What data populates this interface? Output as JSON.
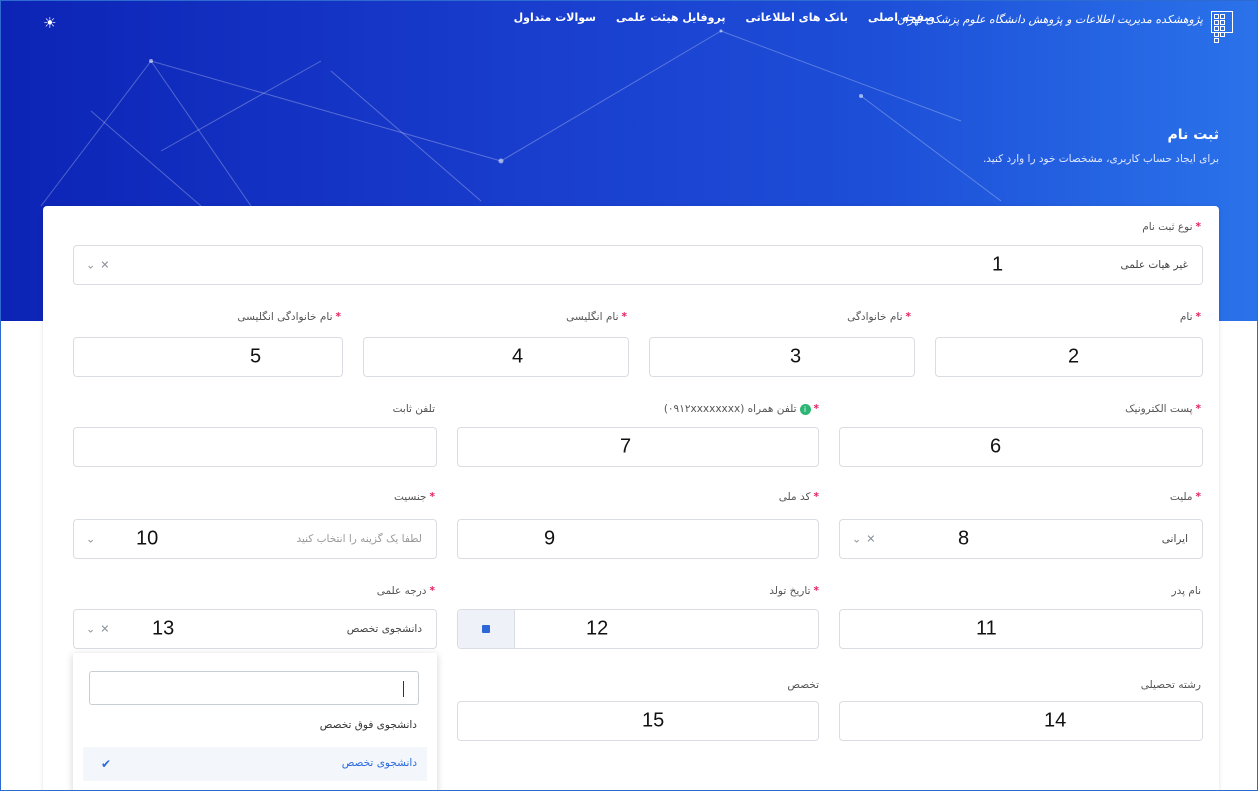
{
  "header": {
    "logo_text": "پژوهشکده مدیریت اطلاعات و پژوهش دانشگاه علوم پزشکی تهران",
    "nav": [
      "صفحه اصلی",
      "بانک های اطلاعاتی",
      "پروفایل هیئت علمی",
      "سوالات متداول"
    ],
    "theme_icon": "☀"
  },
  "page": {
    "title": "ثبت نام",
    "subtitle": "برای ایجاد حساب کاربری، مشخصات خود را وارد کنید."
  },
  "form": {
    "reg_type": {
      "label": "نوع ثبت نام",
      "value": "غیر هیات علمی",
      "marker": "1"
    },
    "first_name": {
      "label": "نام",
      "marker": "2"
    },
    "last_name": {
      "label": "نام خانوادگی",
      "marker": "3"
    },
    "en_first_name": {
      "label": "نام انگلیسی",
      "marker": "4"
    },
    "en_last_name": {
      "label": "نام خانوادگی انگلیسی",
      "marker": "5"
    },
    "email": {
      "label": "پست الکترونیک",
      "marker": "6"
    },
    "mobile": {
      "label": "تلفن همراه (۰۹۱۲xxxxxxxx)",
      "marker": "7"
    },
    "phone": {
      "label": "تلفن ثابت"
    },
    "nationality": {
      "label": "ملیت",
      "value": "ایرانی",
      "marker": "8"
    },
    "national_code": {
      "label": "کد ملی",
      "marker": "9"
    },
    "gender": {
      "label": "جنسیت",
      "placeholder": "لطفا یک گزینه را انتخاب کنید",
      "marker": "10"
    },
    "father_name": {
      "label": "نام پدر",
      "marker": "11"
    },
    "birth_date": {
      "label": "تاریخ تولد",
      "marker": "12"
    },
    "degree": {
      "label": "درجه علمی",
      "value": "دانشجوی تخصص",
      "marker": "13",
      "options": [
        "دانشجوی فوق تخصص",
        "دانشجوی تخصص"
      ]
    },
    "field_of_study": {
      "label": "رشته تحصیلی",
      "marker": "14"
    },
    "specialty": {
      "label": "تخصص",
      "marker": "15"
    }
  },
  "colors": {
    "accent": "#2a6be0",
    "required": "#e0245e",
    "hero": "#1a3fcf"
  },
  "icons": {
    "clear": "✕",
    "chevron": "⌄",
    "check": "✔"
  }
}
